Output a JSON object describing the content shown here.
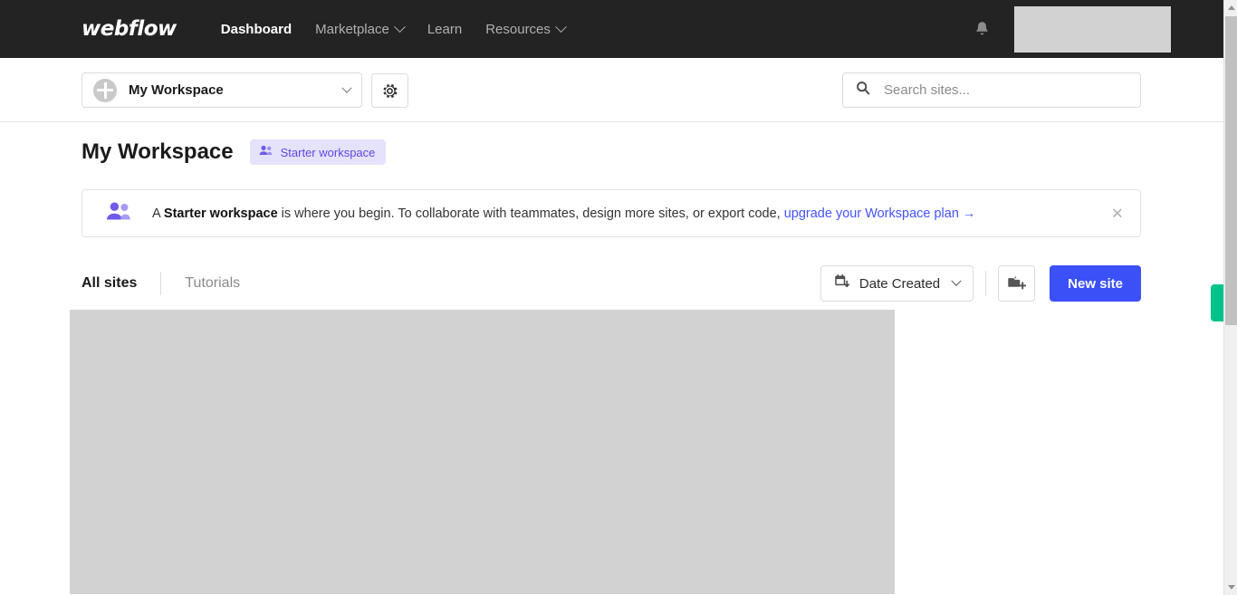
{
  "navbar": {
    "logo": "webflow",
    "links": [
      {
        "label": "Dashboard",
        "has_caret": false,
        "active": true
      },
      {
        "label": "Marketplace",
        "has_caret": true,
        "active": false
      },
      {
        "label": "Learn",
        "has_caret": false,
        "active": false
      },
      {
        "label": "Resources",
        "has_caret": true,
        "active": false
      }
    ],
    "bell_icon": "bell-icon",
    "skeleton_placeholder": ""
  },
  "workspace_bar": {
    "selector": {
      "avatar_icon": "workspace-avatar-icon",
      "name": "My Workspace",
      "caret_icon": "chevron-down-icon"
    },
    "settings_icon": "gear-icon",
    "search": {
      "icon": "search-icon",
      "placeholder": "Search sites...",
      "value": ""
    }
  },
  "main": {
    "title": "My Workspace",
    "badge": {
      "icon": "people-icon",
      "label": "Starter workspace"
    },
    "banner": {
      "icon": "people-icon",
      "text_before": "A ",
      "text_bold": "Starter workspace",
      "text_middle": " is where you begin. To collaborate with teammates, design more sites, or export code, ",
      "link": "upgrade your Workspace plan →",
      "close_icon": "close-icon"
    },
    "tabs": [
      {
        "label": "All sites",
        "active": true
      },
      {
        "label": "Tutorials",
        "active": false
      }
    ],
    "toolbar": {
      "sort": {
        "icon": "calendar-sort-icon",
        "label": "Date Created",
        "caret_icon": "chevron-down-icon"
      },
      "new_folder_icon": "new-folder-icon",
      "new_site_label": "New site"
    },
    "sites_placeholder": ""
  },
  "widgets": {
    "feedback_tab": "feedback-tab"
  },
  "scrollbar": {
    "up_icon": "scroll-up-arrow-icon",
    "down_icon": "scroll-down-arrow-icon"
  },
  "colors": {
    "navbar_bg": "#232323",
    "accent_blue": "#3b50f7",
    "link_blue": "#4353ff",
    "badge_bg": "#e5e2fb",
    "badge_text": "#6046e5",
    "skeleton": "#d2d2d2",
    "feedback_green": "#00c389"
  }
}
